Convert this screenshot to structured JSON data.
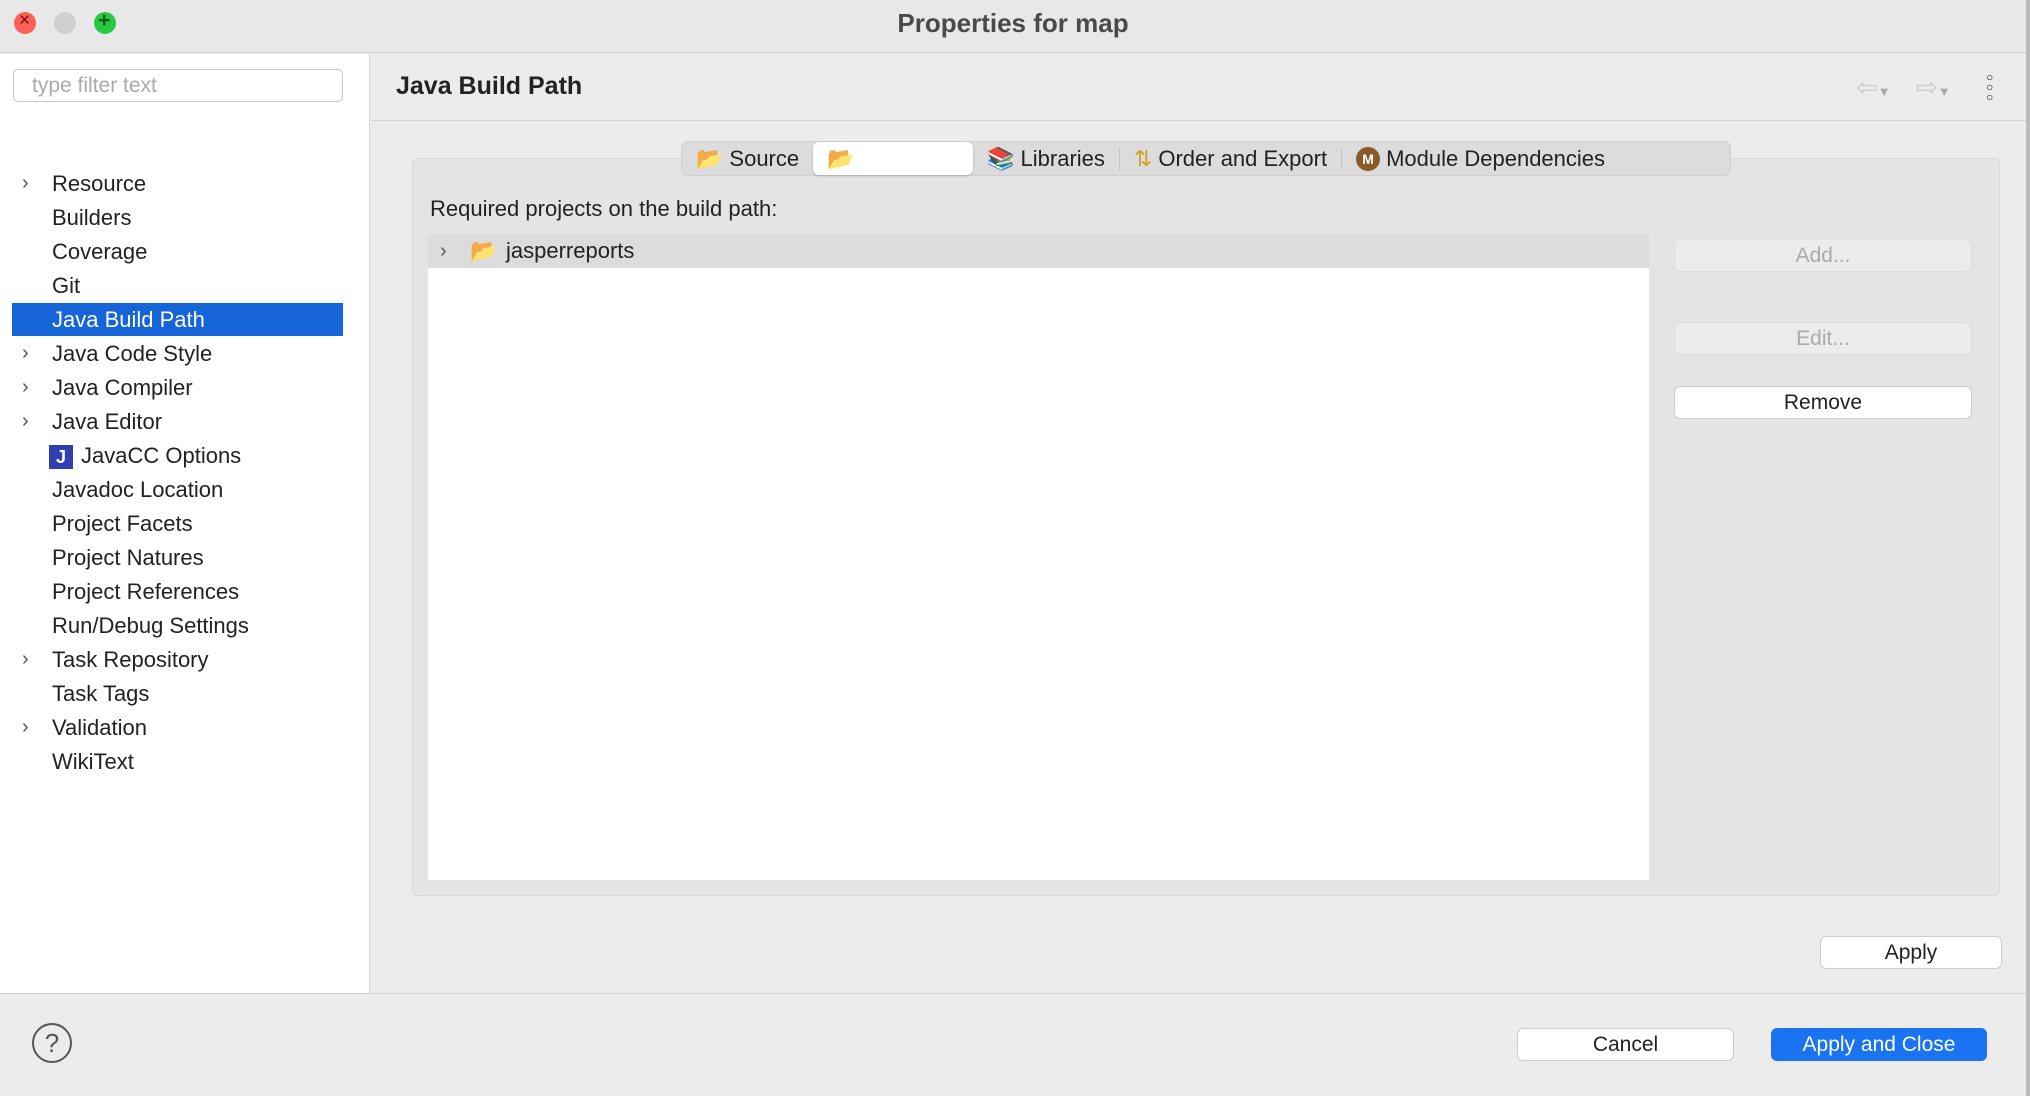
{
  "window": {
    "title": "Properties for map"
  },
  "sidebar": {
    "filter_placeholder": "type filter text",
    "items": [
      {
        "label": "Resource",
        "expandable": true
      },
      {
        "label": "Builders",
        "expandable": false
      },
      {
        "label": "Coverage",
        "expandable": false
      },
      {
        "label": "Git",
        "expandable": false
      },
      {
        "label": "Java Build Path",
        "expandable": false,
        "selected": true
      },
      {
        "label": "Java Code Style",
        "expandable": true
      },
      {
        "label": "Java Compiler",
        "expandable": true
      },
      {
        "label": "Java Editor",
        "expandable": true
      },
      {
        "label": "JavaCC Options",
        "expandable": false,
        "icon": "javacc-icon"
      },
      {
        "label": "Javadoc Location",
        "expandable": false
      },
      {
        "label": "Project Facets",
        "expandable": false
      },
      {
        "label": "Project Natures",
        "expandable": false
      },
      {
        "label": "Project References",
        "expandable": false
      },
      {
        "label": "Run/Debug Settings",
        "expandable": false
      },
      {
        "label": "Task Repository",
        "expandable": true
      },
      {
        "label": "Task Tags",
        "expandable": false
      },
      {
        "label": "Validation",
        "expandable": true
      },
      {
        "label": "WikiText",
        "expandable": false
      }
    ]
  },
  "main": {
    "title": "Java Build Path",
    "tabs": [
      {
        "label": "Source",
        "icon": "source-folder-icon"
      },
      {
        "label": "",
        "icon": "projects-folder-icon",
        "selected": true
      },
      {
        "label": "Libraries",
        "icon": "libraries-icon"
      },
      {
        "label": "Order and Export",
        "icon": "order-export-icon"
      },
      {
        "label": "Module Dependencies",
        "icon": "module-icon"
      }
    ],
    "list_label": "Required projects on the build path:",
    "projects": [
      {
        "label": "jasperreports"
      }
    ],
    "buttons": {
      "add": "Add...",
      "edit": "Edit...",
      "remove": "Remove"
    },
    "apply": "Apply"
  },
  "footer": {
    "cancel": "Cancel",
    "apply_close": "Apply and Close"
  },
  "colors": {
    "accent": "#1665d8"
  }
}
